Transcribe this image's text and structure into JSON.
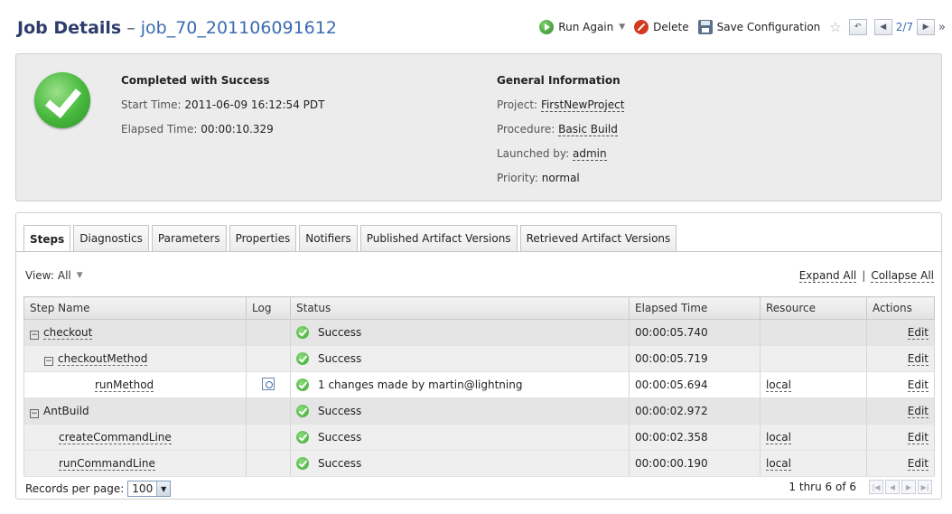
{
  "header": {
    "title": "Job Details",
    "separator": "–",
    "job_name": "job_70_201106091612",
    "toolbar": {
      "run_again": "Run Again",
      "delete": "Delete",
      "save_configuration": "Save Configuration",
      "pager": "2/7",
      "more": "»"
    }
  },
  "summary": {
    "status_heading": "Completed with Success",
    "start_time_label": "Start Time:",
    "start_time": "2011-06-09 16:12:54 PDT",
    "elapsed_label": "Elapsed Time:",
    "elapsed": "00:00:10.329",
    "general_heading": "General Information",
    "project_label": "Project:",
    "project": "FirstNewProject",
    "procedure_label": "Procedure:",
    "procedure": "Basic Build",
    "launched_label": "Launched by:",
    "launched_by": "admin",
    "priority_label": "Priority:",
    "priority": "normal"
  },
  "tabs": [
    "Steps",
    "Diagnostics",
    "Parameters",
    "Properties",
    "Notifiers",
    "Published Artifact Versions",
    "Retrieved Artifact Versions"
  ],
  "view": {
    "label": "View:",
    "value": "All"
  },
  "actions": {
    "expand_all": "Expand All",
    "separator": "|",
    "collapse_all": "Collapse All"
  },
  "table": {
    "columns": [
      "Step Name",
      "Log",
      "Status",
      "Elapsed Time",
      "Resource",
      "Actions"
    ],
    "rows": [
      {
        "name": "checkout",
        "toggle": "−",
        "status": "Success",
        "elapsed": "00:00:05.740",
        "resource": "",
        "action": "Edit"
      },
      {
        "name": "checkoutMethod",
        "toggle": "−",
        "status": "Success",
        "elapsed": "00:00:05.719",
        "resource": "",
        "action": "Edit"
      },
      {
        "name": "runMethod",
        "toggle": "",
        "status": "1 changes made by martin@lightning",
        "elapsed": "00:00:05.694",
        "resource": "local",
        "action": "Edit"
      },
      {
        "name": "AntBuild",
        "toggle": "−",
        "status": "Success",
        "elapsed": "00:00:02.972",
        "resource": "",
        "action": "Edit"
      },
      {
        "name": "createCommandLine",
        "toggle": "",
        "status": "Success",
        "elapsed": "00:00:02.358",
        "resource": "local",
        "action": "Edit"
      },
      {
        "name": "runCommandLine",
        "toggle": "",
        "status": "Success",
        "elapsed": "00:00:00.190",
        "resource": "local",
        "action": "Edit"
      }
    ]
  },
  "footer": {
    "records_label": "Records per page:",
    "records_value": "100",
    "range": "1 thru 6 of 6"
  },
  "icons": {
    "run_again": "play-icon",
    "delete": "delete-icon",
    "save": "save-icon",
    "favorite": "star-icon",
    "status": "success-check-icon",
    "log": "log-file-icon"
  },
  "colors": {
    "accent": "#2c3d6c",
    "link": "#3a6bb0",
    "success": "#46b83c",
    "delete": "#d23a20"
  }
}
